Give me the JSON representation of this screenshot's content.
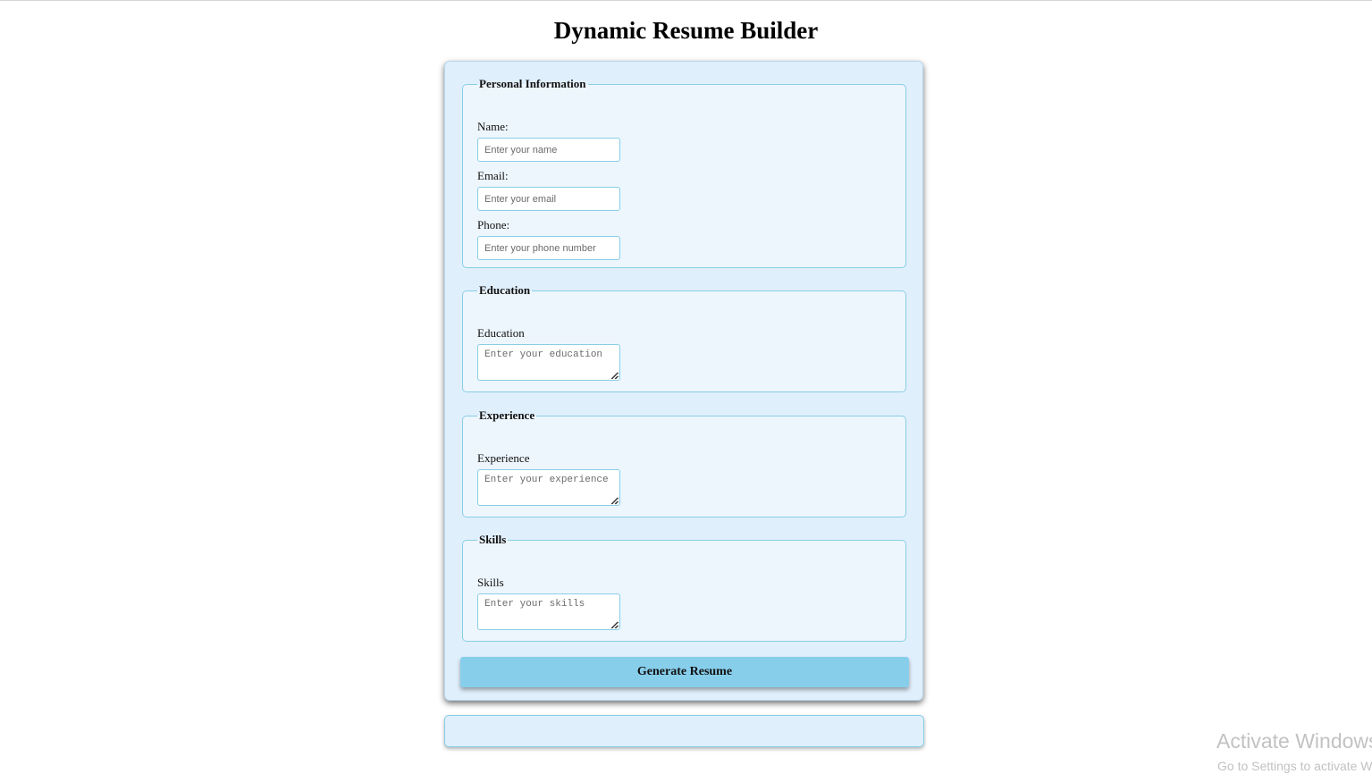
{
  "page": {
    "title": "Dynamic Resume Builder"
  },
  "personal": {
    "legend": "Personal Information",
    "name_label": "Name:",
    "name_placeholder": "Enter your name",
    "email_label": "Email:",
    "email_placeholder": "Enter your email",
    "phone_label": "Phone:",
    "phone_placeholder": "Enter your phone number"
  },
  "education": {
    "legend": "Education",
    "label": "Education",
    "placeholder": "Enter your education"
  },
  "experience": {
    "legend": "Experience",
    "label": "Experience",
    "placeholder": "Enter your experience"
  },
  "skills": {
    "legend": "Skills",
    "label": "Skills",
    "placeholder": "Enter your skills"
  },
  "actions": {
    "generate_label": "Generate Resume"
  },
  "watermark": {
    "title": "Activate Windows",
    "subtitle": "Go to Settings to activate Windows."
  },
  "colors": {
    "card_background": "#e0effc",
    "fieldset_border": "#87cee6",
    "button_background": "#87ceeb"
  },
  "icons": {
    "resize_grip": "resize-grip-icon"
  }
}
